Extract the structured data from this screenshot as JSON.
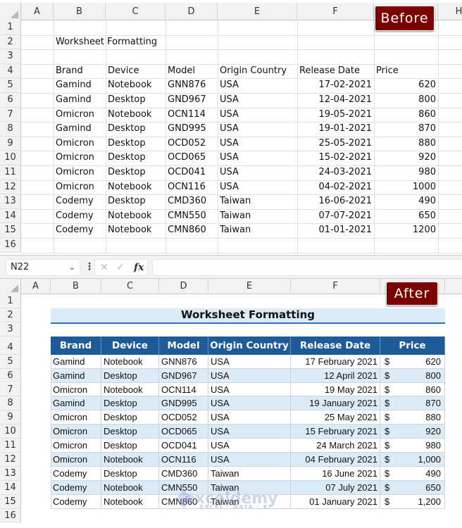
{
  "before": {
    "tag": "Before",
    "columns": [
      "A",
      "B",
      "C",
      "D",
      "E",
      "F",
      "",
      "H"
    ],
    "rows": [
      "1",
      "2",
      "3",
      "4",
      "5",
      "6",
      "7",
      "8",
      "9",
      "10",
      "11",
      "12",
      "13",
      "14",
      "15",
      "16"
    ],
    "title": "Worksheet Formatting",
    "headers": [
      "Brand",
      "Device",
      "Model",
      "Origin Country",
      "Release Date",
      "Price"
    ],
    "data": [
      [
        "Gamind",
        "Notebook",
        "GNN876",
        "USA",
        "17-02-2021",
        "620"
      ],
      [
        "Gamind",
        "Desktop",
        "GND967",
        "USA",
        "12-04-2021",
        "800"
      ],
      [
        "Omicron",
        "Notebook",
        "OCN114",
        "USA",
        "19-05-2021",
        "860"
      ],
      [
        "Gamind",
        "Desktop",
        "GND995",
        "USA",
        "19-01-2021",
        "870"
      ],
      [
        "Omicron",
        "Desktop",
        "OCD052",
        "USA",
        "25-05-2021",
        "880"
      ],
      [
        "Omicron",
        "Desktop",
        "OCD065",
        "USA",
        "15-02-2021",
        "920"
      ],
      [
        "Omicron",
        "Desktop",
        "OCD041",
        "USA",
        "24-03-2021",
        "980"
      ],
      [
        "Omicron",
        "Notebook",
        "OCN116",
        "USA",
        "04-02-2021",
        "1000"
      ],
      [
        "Codemy",
        "Desktop",
        "CMD360",
        "Taiwan",
        "16-06-2021",
        "490"
      ],
      [
        "Codemy",
        "Notebook",
        "CMN550",
        "Taiwan",
        "07-07-2021",
        "650"
      ],
      [
        "Codemy",
        "Notebook",
        "CMN860",
        "Taiwan",
        "01-01-2021",
        "1200"
      ]
    ]
  },
  "formula_bar": {
    "name_box": "N22",
    "chevron": "⌄",
    "more": "⋮",
    "cancel": "✕",
    "enter": "✓",
    "fx": "fx",
    "formula": ""
  },
  "after": {
    "tag": "After",
    "columns": [
      "A",
      "B",
      "C",
      "D",
      "E",
      "F",
      ""
    ],
    "rows": [
      "1",
      "2",
      "3",
      "4",
      "5",
      "6",
      "7",
      "8",
      "9",
      "10",
      "11",
      "12",
      "13",
      "14",
      "15",
      "16"
    ],
    "title": "Worksheet Formatting",
    "headers": [
      "Brand",
      "Device",
      "Model",
      "Origin Country",
      "Release Date",
      "Price"
    ],
    "currency": "$",
    "data": [
      [
        "Gamind",
        "Notebook",
        "GNN876",
        "USA",
        "17 February 2021",
        "620"
      ],
      [
        "Gamind",
        "Desktop",
        "GND967",
        "USA",
        "12 April 2021",
        "800"
      ],
      [
        "Omicron",
        "Notebook",
        "OCN114",
        "USA",
        "19 May 2021",
        "860"
      ],
      [
        "Gamind",
        "Desktop",
        "GND995",
        "USA",
        "19 January 2021",
        "870"
      ],
      [
        "Omicron",
        "Desktop",
        "OCD052",
        "USA",
        "25 May 2021",
        "880"
      ],
      [
        "Omicron",
        "Desktop",
        "OCD065",
        "USA",
        "15 February 2021",
        "920"
      ],
      [
        "Omicron",
        "Desktop",
        "OCD041",
        "USA",
        "24 March 2021",
        "980"
      ],
      [
        "Omicron",
        "Notebook",
        "OCN116",
        "USA",
        "04 February 2021",
        "1,000"
      ],
      [
        "Codemy",
        "Desktop",
        "CMD360",
        "Taiwan",
        "16 June 2021",
        "490"
      ],
      [
        "Codemy",
        "Notebook",
        "CMN550",
        "Taiwan",
        "07 July 2021",
        "650"
      ],
      [
        "Codemy",
        "Notebook",
        "CMN860",
        "Taiwan",
        "01 January 2021",
        "1,200"
      ]
    ]
  },
  "colors": {
    "tag_bg": "#7b0000",
    "header_bg": "#1f5a99",
    "band_bg": "#ddebf7",
    "title_underline": "#2f75b5"
  },
  "watermark": {
    "name": "exceldemy",
    "sub": "EXCEL · DATA · BI"
  }
}
